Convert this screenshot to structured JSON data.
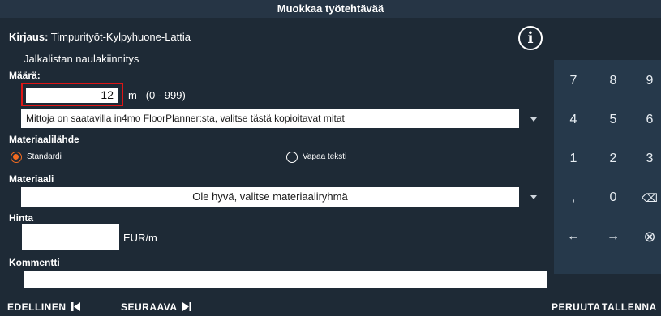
{
  "window": {
    "title": "Muokkaa työtehtävää"
  },
  "entry": {
    "label": "Kirjaus:",
    "value": "Timpurityöt-Kylpyhuone-Lattia",
    "subtitle": "Jalkalistan naulakiinnitys"
  },
  "quantity": {
    "label": "Määrä:",
    "value": "12",
    "unit": "m",
    "range": "(0 - 999)"
  },
  "measure_dropdown": {
    "text": "Mittoja on saatavilla in4mo FloorPlanner:sta, valitse tästä kopioitavat mitat"
  },
  "material_source": {
    "label": "Materiaalilähde",
    "options": [
      {
        "label": "Standardi",
        "selected": true
      },
      {
        "label": "Vapaa teksti",
        "selected": false
      }
    ]
  },
  "material": {
    "label": "Materiaali",
    "dropdown_text": "Ole hyvä, valitse materiaaliryhmä"
  },
  "price": {
    "label": "Hinta",
    "value": "",
    "unit": "EUR/m"
  },
  "comment": {
    "label": "Kommentti",
    "value": ""
  },
  "numpad": {
    "keys": [
      "7",
      "8",
      "9",
      "4",
      "5",
      "6",
      "1",
      "2",
      "3",
      ",",
      "0",
      "⌫",
      "←",
      "→",
      "⊗"
    ]
  },
  "bottom": {
    "prev": "EDELLINEN",
    "next": "SEURAAVA",
    "cancel": "PERUUTA",
    "save": "TALLENNA"
  },
  "colors": {
    "accent": "#f26b21",
    "highlight_border": "#e01515",
    "background": "#1e2a36",
    "numpad": "#26394b"
  }
}
